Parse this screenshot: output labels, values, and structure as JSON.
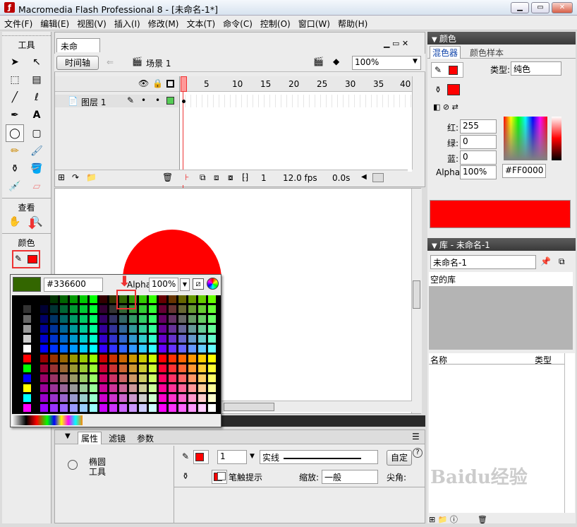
{
  "window": {
    "title": "Macromedia Flash Professional 8 - [未命名-1*]"
  },
  "menu": [
    "文件(F)",
    "编辑(E)",
    "视图(V)",
    "插入(I)",
    "修改(M)",
    "文本(T)",
    "命令(C)",
    "控制(O)",
    "窗口(W)",
    "帮助(H)"
  ],
  "tools": {
    "label": "工具",
    "view_label": "查看",
    "color_label": "颜色"
  },
  "document": {
    "tab": "未命名-1*",
    "timeline_button": "时间轴",
    "scene": "场景 1",
    "zoom": "100%"
  },
  "timeline": {
    "frame_numbers": [
      "1",
      "5",
      "10",
      "15",
      "20",
      "25",
      "30",
      "35",
      "40"
    ],
    "layer_name": "图层 1",
    "current_frame": "1",
    "fps": "12.0 fps",
    "time": "0.0s"
  },
  "palette": {
    "hex": "#336600",
    "alpha_label": "Alpha:",
    "alpha": "100%",
    "selected_color": "#336600"
  },
  "color_mixer": {
    "panel_title": "颜色",
    "tab_mixer": "混色器",
    "tab_swatches": "颜色样本",
    "type_label": "类型:",
    "type_value": "纯色",
    "red_label": "红:",
    "red": "255",
    "green_label": "绿:",
    "green": "0",
    "blue_label": "蓝:",
    "blue": "0",
    "alpha_label": "Alpha:",
    "alpha": "100%",
    "hex": "#FF0000",
    "fill_color": "#FF0000"
  },
  "library": {
    "panel_title": "库 - 未命名-1",
    "doc_select": "未命名-1",
    "empty_text": "空的库",
    "col_name": "名称",
    "col_type": "类型"
  },
  "properties": {
    "tab_props": "属性",
    "tab_filters": "滤镜",
    "tab_params": "参数",
    "tool_name": "椭圆\n工具",
    "stroke_width": "1",
    "stroke_style": "实线",
    "custom_button": "自定",
    "hint_label": "笔触提示",
    "scale_label": "缩放:",
    "scale_value": "一般",
    "corner_label": "尖角:"
  },
  "watermark": "Baidu经验"
}
